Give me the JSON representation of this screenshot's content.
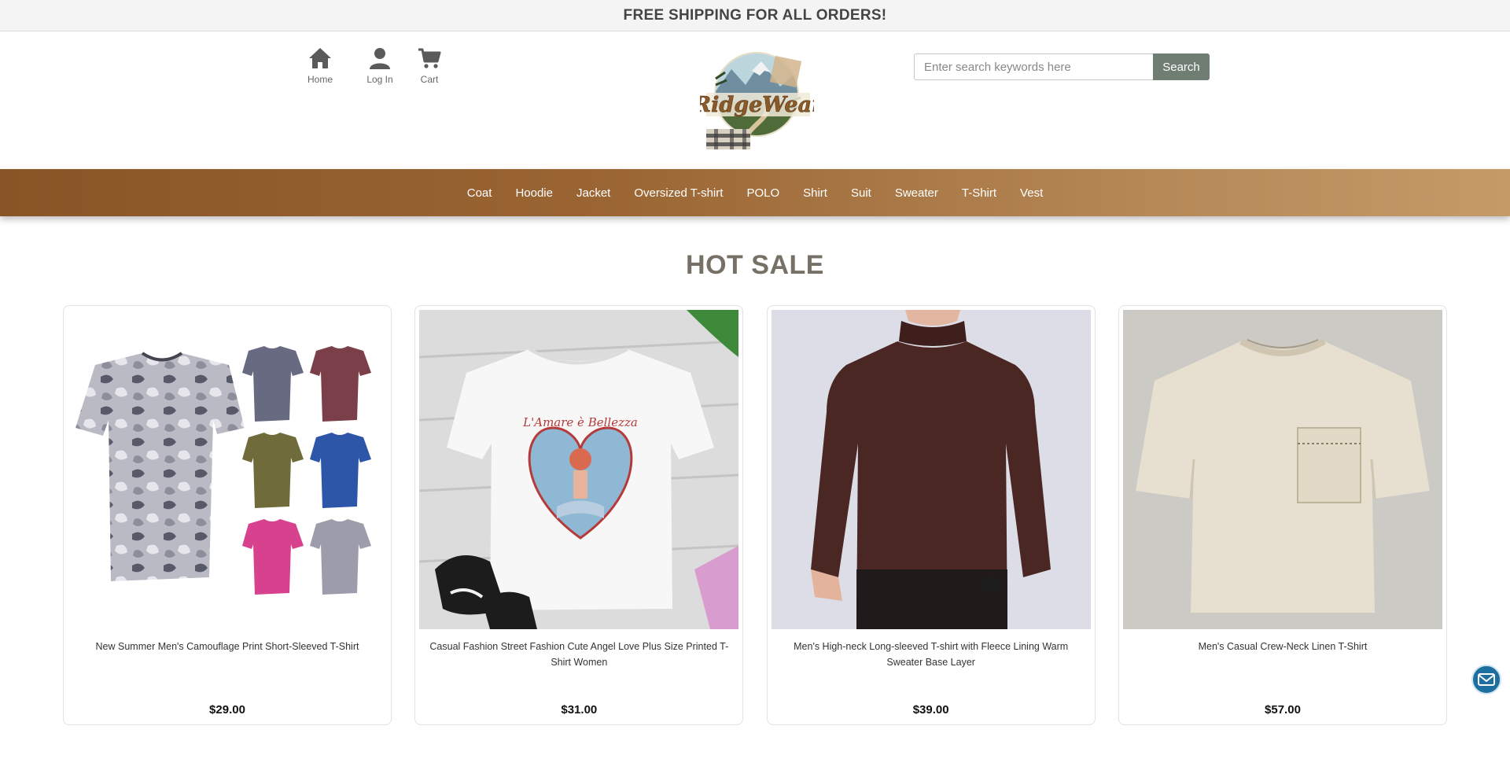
{
  "announcement": {
    "text": "FREE SHIPPING FOR ALL ORDERS!"
  },
  "header": {
    "quicklinks": [
      {
        "label": "Home",
        "icon": "home-icon"
      },
      {
        "label": "Log In",
        "icon": "user-icon"
      },
      {
        "label": "Cart",
        "icon": "cart-icon"
      }
    ],
    "logo": {
      "text": "RidgeWear"
    },
    "search": {
      "placeholder": "Enter search keywords here",
      "button_label": "Search"
    }
  },
  "nav": {
    "items": [
      "Coat",
      "Hoodie",
      "Jacket",
      "Oversized T-shirt",
      "POLO",
      "Shirt",
      "Suit",
      "Sweater",
      "T-Shirt",
      "Vest"
    ]
  },
  "section": {
    "title": "HOT SALE"
  },
  "products": [
    {
      "name": "New Summer Men's Camouflage Print Short-Sleeved T-Shirt",
      "price": "$29.00",
      "image": "camo-tshirt-image"
    },
    {
      "name": "Casual Fashion Street Fashion Cute Angel Love Plus Size Printed T-Shirt Women",
      "price": "$31.00",
      "image": "angel-heart-tshirt-image",
      "image_text": "L'Amare è Bellezza"
    },
    {
      "name": "Men's High-neck Long-sleeved T-shirt with Fleece Lining Warm Sweater Base Layer",
      "price": "$39.00",
      "image": "brown-turtleneck-image"
    },
    {
      "name": "Men's Casual Crew-Neck Linen T-Shirt",
      "price": "$57.00",
      "image": "linen-tshirt-image"
    }
  ],
  "contact": {
    "icon": "mail-icon"
  },
  "colors": {
    "nav_start": "#8a5526",
    "nav_end": "#c59a67",
    "search_button": "#6f7d72",
    "mail_button": "#1c6fa0"
  }
}
